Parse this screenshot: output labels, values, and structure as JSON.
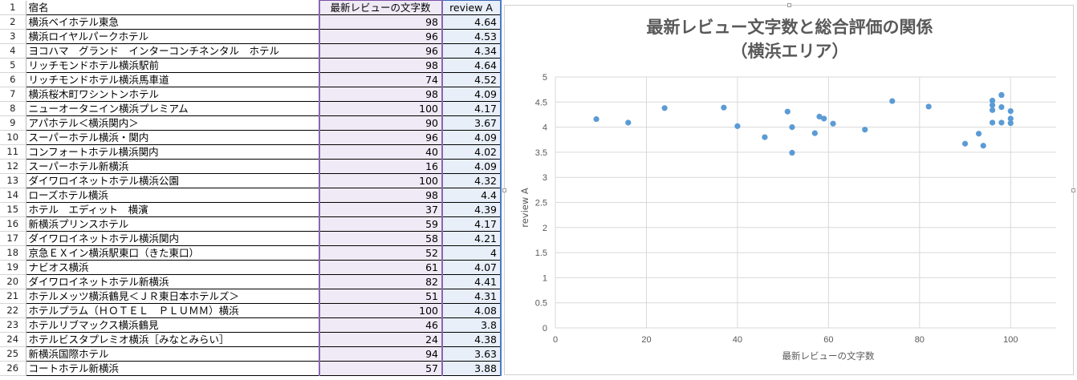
{
  "sheet": {
    "headers": {
      "row_number": "1",
      "name": "宿名",
      "review_length": "最新レビューの文字数",
      "review_a": "review A"
    },
    "rows": [
      {
        "row": "2",
        "name": "横浜ベイホテル東急",
        "len": "98",
        "rev": "4.64"
      },
      {
        "row": "3",
        "name": "横浜ロイヤルパークホテル",
        "len": "96",
        "rev": "4.53"
      },
      {
        "row": "4",
        "name": "ヨコハマ　グランド　インターコンチネンタル　ホテル",
        "len": "96",
        "rev": "4.34"
      },
      {
        "row": "5",
        "name": "リッチモンドホテル横浜駅前",
        "len": "98",
        "rev": "4.64"
      },
      {
        "row": "6",
        "name": "リッチモンドホテル横浜馬車道",
        "len": "74",
        "rev": "4.52"
      },
      {
        "row": "7",
        "name": "横浜桜木町ワシントンホテル",
        "len": "98",
        "rev": "4.09"
      },
      {
        "row": "8",
        "name": "ニューオータニイン横浜プレミアム",
        "len": "100",
        "rev": "4.17"
      },
      {
        "row": "9",
        "name": "アパホテル＜横浜関内＞",
        "len": "90",
        "rev": "3.67"
      },
      {
        "row": "10",
        "name": "スーパーホテル横浜・関内",
        "len": "96",
        "rev": "4.09"
      },
      {
        "row": "11",
        "name": "コンフォートホテル横浜関内",
        "len": "40",
        "rev": "4.02"
      },
      {
        "row": "12",
        "name": "スーパーホテル新横浜",
        "len": "16",
        "rev": "4.09"
      },
      {
        "row": "13",
        "name": "ダイワロイネットホテル横浜公園",
        "len": "100",
        "rev": "4.32"
      },
      {
        "row": "14",
        "name": "ローズホテル横浜",
        "len": "98",
        "rev": "4.4"
      },
      {
        "row": "15",
        "name": "ホテル　エディット　横濱",
        "len": "37",
        "rev": "4.39"
      },
      {
        "row": "16",
        "name": "新横浜プリンスホテル",
        "len": "59",
        "rev": "4.17"
      },
      {
        "row": "17",
        "name": "ダイワロイネットホテル横浜関内",
        "len": "58",
        "rev": "4.21"
      },
      {
        "row": "18",
        "name": "京急ＥＸイン横浜駅東口（きた東口）",
        "len": "52",
        "rev": "4"
      },
      {
        "row": "19",
        "name": "ナビオス横浜",
        "len": "61",
        "rev": "4.07"
      },
      {
        "row": "20",
        "name": "ダイワロイネットホテル新横浜",
        "len": "82",
        "rev": "4.41"
      },
      {
        "row": "21",
        "name": "ホテルメッツ横浜鶴見＜ＪＲ東日本ホテルズ＞",
        "len": "51",
        "rev": "4.31"
      },
      {
        "row": "22",
        "name": "ホテルプラム（ＨＯＴＥＬ　ＰＬＵＭＭ）横浜",
        "len": "100",
        "rev": "4.08"
      },
      {
        "row": "23",
        "name": "ホテルリブマックス横浜鶴見",
        "len": "46",
        "rev": "3.8"
      },
      {
        "row": "24",
        "name": "ホテルビスタプレミオ横浜［みなとみらい］",
        "len": "24",
        "rev": "4.38"
      },
      {
        "row": "25",
        "name": "新横浜国際ホテル",
        "len": "94",
        "rev": "3.63"
      },
      {
        "row": "26",
        "name": "コートホテル新横浜",
        "len": "57",
        "rev": "3.88"
      }
    ]
  },
  "chart_data": {
    "type": "scatter",
    "title_line1": "最新レビュー文字数と総合評価の関係",
    "title_line2": "（横浜エリア）",
    "xlabel": "最新レビューの文字数",
    "ylabel": "review A",
    "xlim": [
      0,
      110
    ],
    "ylim": [
      0,
      5
    ],
    "xticks": [
      0,
      20,
      40,
      60,
      80,
      100
    ],
    "yticks": [
      0,
      0.5,
      1,
      1.5,
      2,
      2.5,
      3,
      3.5,
      4,
      4.5,
      5
    ],
    "grid": true,
    "legend": "none",
    "marker_color": "#5b9bd5",
    "points": [
      [
        98,
        4.64
      ],
      [
        96,
        4.53
      ],
      [
        96,
        4.34
      ],
      [
        98,
        4.64
      ],
      [
        74,
        4.52
      ],
      [
        98,
        4.09
      ],
      [
        100,
        4.17
      ],
      [
        90,
        3.67
      ],
      [
        96,
        4.09
      ],
      [
        40,
        4.02
      ],
      [
        16,
        4.09
      ],
      [
        100,
        4.32
      ],
      [
        98,
        4.4
      ],
      [
        37,
        4.39
      ],
      [
        59,
        4.17
      ],
      [
        58,
        4.21
      ],
      [
        52,
        4
      ],
      [
        61,
        4.07
      ],
      [
        82,
        4.41
      ],
      [
        51,
        4.31
      ],
      [
        100,
        4.08
      ],
      [
        46,
        3.8
      ],
      [
        24,
        4.38
      ],
      [
        94,
        3.63
      ],
      [
        57,
        3.88
      ],
      [
        9,
        4.16
      ],
      [
        96,
        4.44
      ],
      [
        52,
        3.49
      ],
      [
        68,
        3.95
      ],
      [
        93,
        3.87
      ]
    ]
  }
}
